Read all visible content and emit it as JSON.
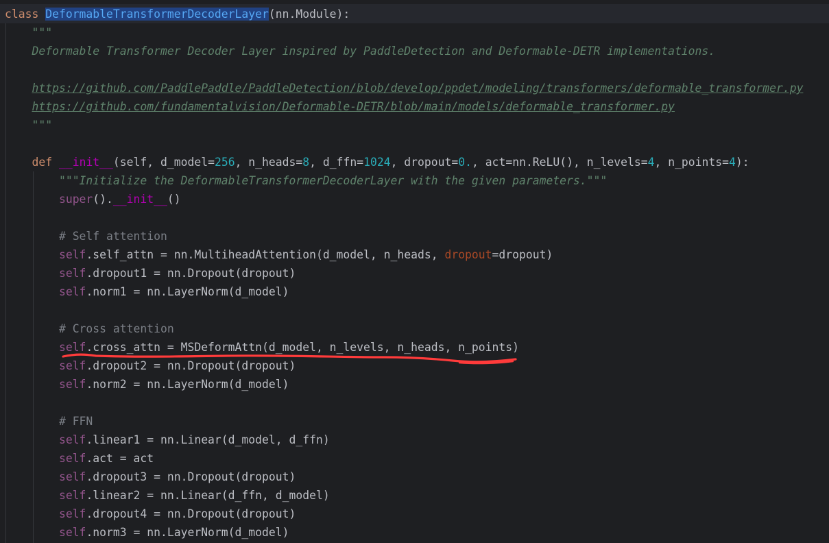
{
  "code": {
    "class_kw": "class",
    "class_name": "DeformableTransformerDecoderLayer",
    "class_base": "(nn.Module):",
    "doc_open": "\"\"\"",
    "doc_line1": "Deformable Transformer Decoder Layer inspired by PaddleDetection and Deformable-DETR implementations.",
    "doc_link1": "https://github.com/PaddlePaddle/PaddleDetection/blob/develop/ppdet/modeling/transformers/deformable_transformer.py",
    "doc_link2": "https://github.com/fundamentalvision/Deformable-DETR/blob/main/models/deformable_transformer.py",
    "doc_close": "\"\"\"",
    "def_kw": "def",
    "init_name": "__init__",
    "init_params": {
      "p0": "(self, d_model=",
      "v_d_model": "256",
      "p1": ", n_heads=",
      "v_n_heads": "8",
      "p2": ", d_ffn=",
      "v_d_ffn": "1024",
      "p3": ", dropout=",
      "v_dropout": "0.",
      "p4": ", act=nn.ReLU(), n_levels=",
      "v_n_levels": "4",
      "p5": ", n_points=",
      "v_n_points": "4",
      "p6": "):"
    },
    "init_doc": "\"\"\"Initialize the DeformableTransformerDecoderLayer with the given parameters.\"\"\"",
    "super_call": "super",
    "super_rest1": "().",
    "super_rest2": "()",
    "self_kw": "self",
    "cmt_self_attn": "# Self attention",
    "l_self_attn_a": ".self_attn = nn.MultiheadAttention(d_model, n_heads, ",
    "l_self_attn_kw": "dropout",
    "l_self_attn_b": "=dropout)",
    "l_dropout1": ".dropout1 = nn.Dropout(dropout)",
    "l_norm1": ".norm1 = nn.LayerNorm(d_model)",
    "cmt_cross_attn": "# Cross attention",
    "l_cross_attn": ".cross_attn = MSDeformAttn(d_model, n_levels, n_heads, n_points)",
    "l_dropout2": ".dropout2 = nn.Dropout(dropout)",
    "l_norm2": ".norm2 = nn.LayerNorm(d_model)",
    "cmt_ffn": "# FFN",
    "l_linear1": ".linear1 = nn.Linear(d_model, d_ffn)",
    "l_act": ".act = act",
    "l_dropout3": ".dropout3 = nn.Dropout(dropout)",
    "l_linear2": ".linear2 = nn.Linear(d_ffn, d_model)",
    "l_dropout4": ".dropout4 = nn.Dropout(dropout)",
    "l_norm3": ".norm3 = nn.LayerNorm(d_model)"
  },
  "colors": {
    "background": "#1e1f22",
    "keyword": "#cf8e6d",
    "docstring": "#5f826b",
    "number": "#2aacb8",
    "self": "#94558d",
    "comment": "#7a7e85",
    "named_arg": "#aa4926",
    "selection": "#214283",
    "annotation": "#ff3b3b"
  }
}
